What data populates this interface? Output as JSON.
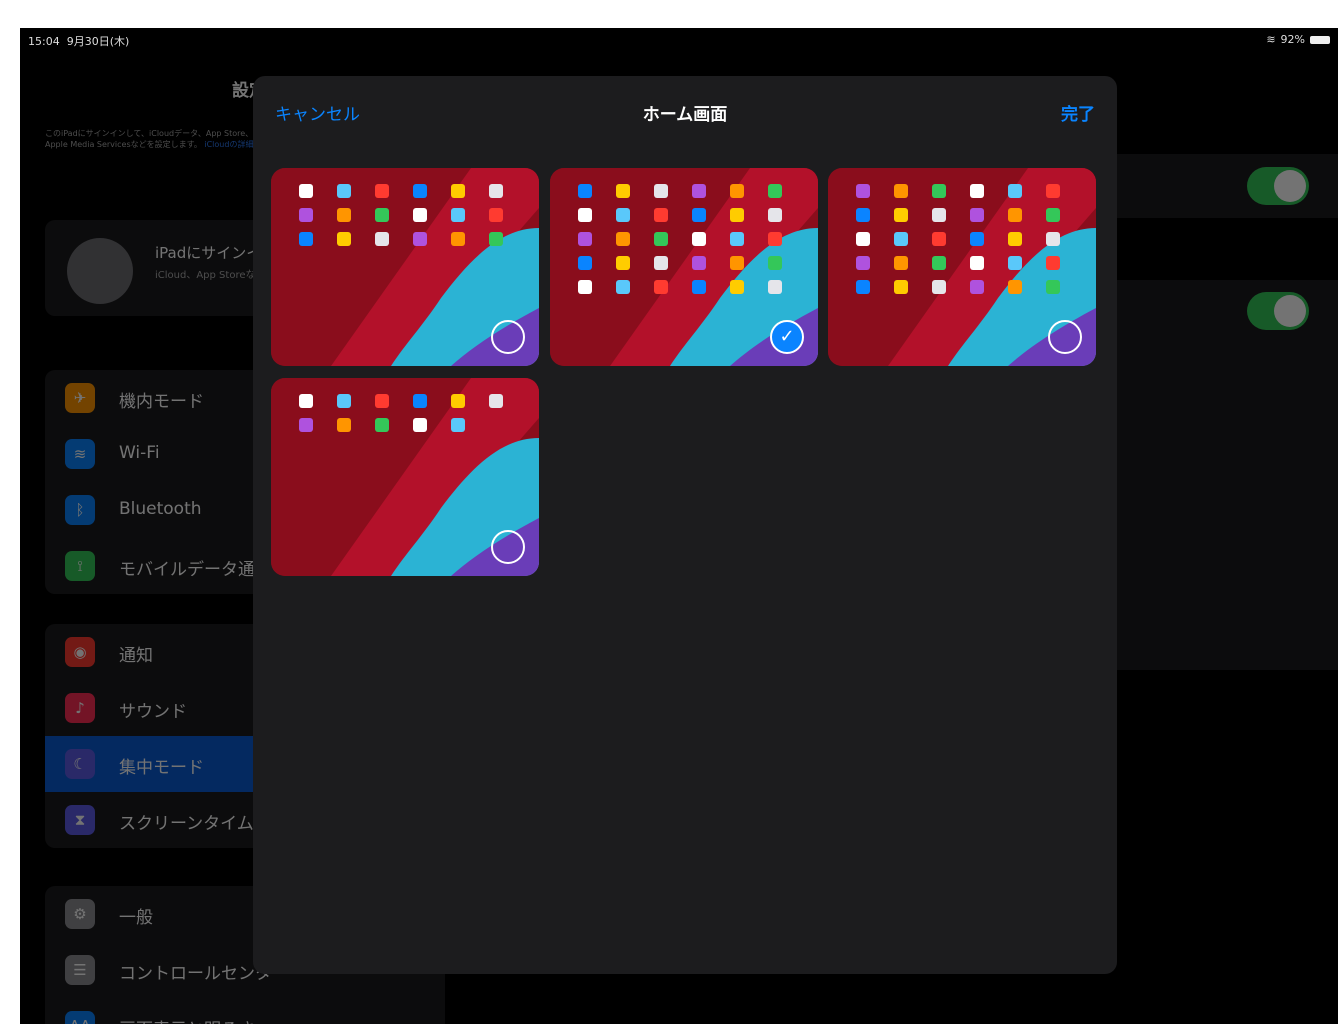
{
  "status_bar": {
    "time": "15:04",
    "date": "9月30日(木)",
    "battery": "92%"
  },
  "settings": {
    "title": "設定",
    "signin_text": "このiPadにサインインして、iCloudデータ、App Store、Apple Media Servicesなどを設定します。",
    "signin_link": "iCloudの詳細",
    "profile": {
      "name": "iPadにサインイン",
      "subtitle": "iCloud、App Storeなど"
    },
    "groups": [
      {
        "items": [
          {
            "label": "機内モード",
            "icon": "airplane-icon",
            "color": "#ff9500",
            "glyph": "✈"
          },
          {
            "label": "Wi-Fi",
            "icon": "wifi-icon",
            "color": "#0a84ff",
            "glyph": "≋"
          },
          {
            "label": "Bluetooth",
            "icon": "bluetooth-icon",
            "color": "#0a84ff",
            "glyph": "ᛒ"
          },
          {
            "label": "モバイルデータ通信",
            "icon": "cellular-icon",
            "color": "#34c759",
            "glyph": "⟟"
          }
        ]
      },
      {
        "items": [
          {
            "label": "通知",
            "icon": "notifications-icon",
            "color": "#ff3b30",
            "glyph": "◉"
          },
          {
            "label": "サウンド",
            "icon": "sound-icon",
            "color": "#ff2d55",
            "glyph": "♪"
          },
          {
            "label": "集中モード",
            "icon": "moon-icon",
            "color": "#5e5ce6",
            "glyph": "☾",
            "selected": true
          },
          {
            "label": "スクリーンタイム",
            "icon": "hourglass-icon",
            "color": "#5e5ce6",
            "glyph": "⧗"
          }
        ]
      },
      {
        "items": [
          {
            "label": "一般",
            "icon": "gear-icon",
            "color": "#8e8e93",
            "glyph": "⚙"
          },
          {
            "label": "コントロールセンター",
            "icon": "control-center-icon",
            "color": "#8e8e93",
            "glyph": "☰"
          },
          {
            "label": "画面表示と明るさ",
            "icon": "display-icon",
            "color": "#0a84ff",
            "glyph": "AA"
          }
        ]
      }
    ]
  },
  "modal": {
    "cancel_label": "キャンセル",
    "title": "ホーム画面",
    "done_label": "完了",
    "pages": [
      {
        "name": "page-1",
        "selected": false
      },
      {
        "name": "page-2",
        "selected": true
      },
      {
        "name": "page-3",
        "selected": false
      },
      {
        "name": "page-4",
        "selected": false
      }
    ]
  },
  "colors": {
    "accent": "#0a84ff",
    "toggle_on": "#34c759",
    "sheet_bg": "#1c1c1e"
  }
}
